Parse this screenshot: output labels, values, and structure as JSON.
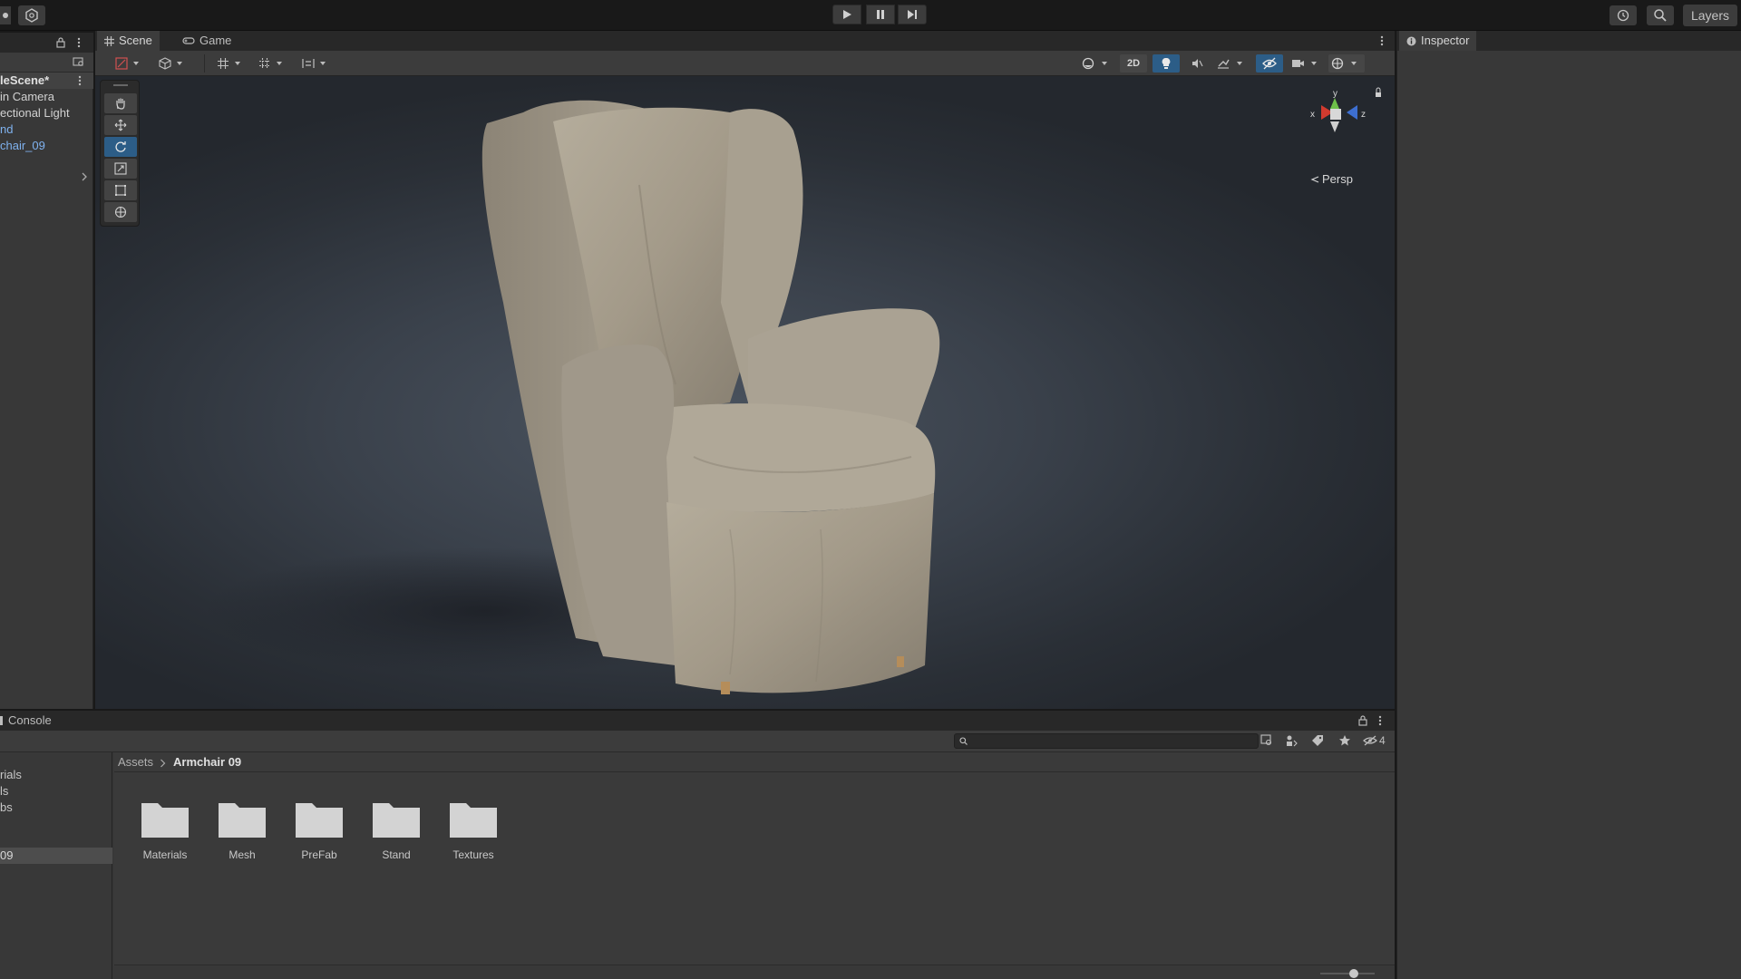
{
  "toolbar": {
    "layers_label": "Layers"
  },
  "hierarchy": {
    "scene_name": "leScene*",
    "items": [
      {
        "label": "in Camera"
      },
      {
        "label": "ectional Light"
      },
      {
        "label": "nd"
      },
      {
        "label": "chair_09"
      }
    ]
  },
  "scene_tabs": [
    {
      "label": "Scene"
    },
    {
      "label": "Game"
    }
  ],
  "scene_toolbar": {
    "mode_2d_label": "2D"
  },
  "scene_view": {
    "projection_label": "Persp",
    "gizmo_axes": {
      "x": "x",
      "y": "y",
      "z": "z"
    }
  },
  "inspector": {
    "tab_label": "Inspector"
  },
  "bottom_panel": {
    "tab_label": "Console",
    "hidden_count": "4",
    "breadcrumb": {
      "root": "Assets",
      "current": "Armchair 09"
    },
    "tree_items": [
      {
        "label": "rials"
      },
      {
        "label": "ls"
      },
      {
        "label": "bs"
      },
      {
        "label": "09"
      }
    ],
    "folders": [
      {
        "label": "Materials"
      },
      {
        "label": "Mesh"
      },
      {
        "label": "PreFab"
      },
      {
        "label": "Stand"
      },
      {
        "label": "Textures"
      }
    ]
  },
  "colors": {
    "selection_blue": "#2c5d87",
    "link_blue": "#7fb2ef",
    "panel_bg": "#383838"
  }
}
